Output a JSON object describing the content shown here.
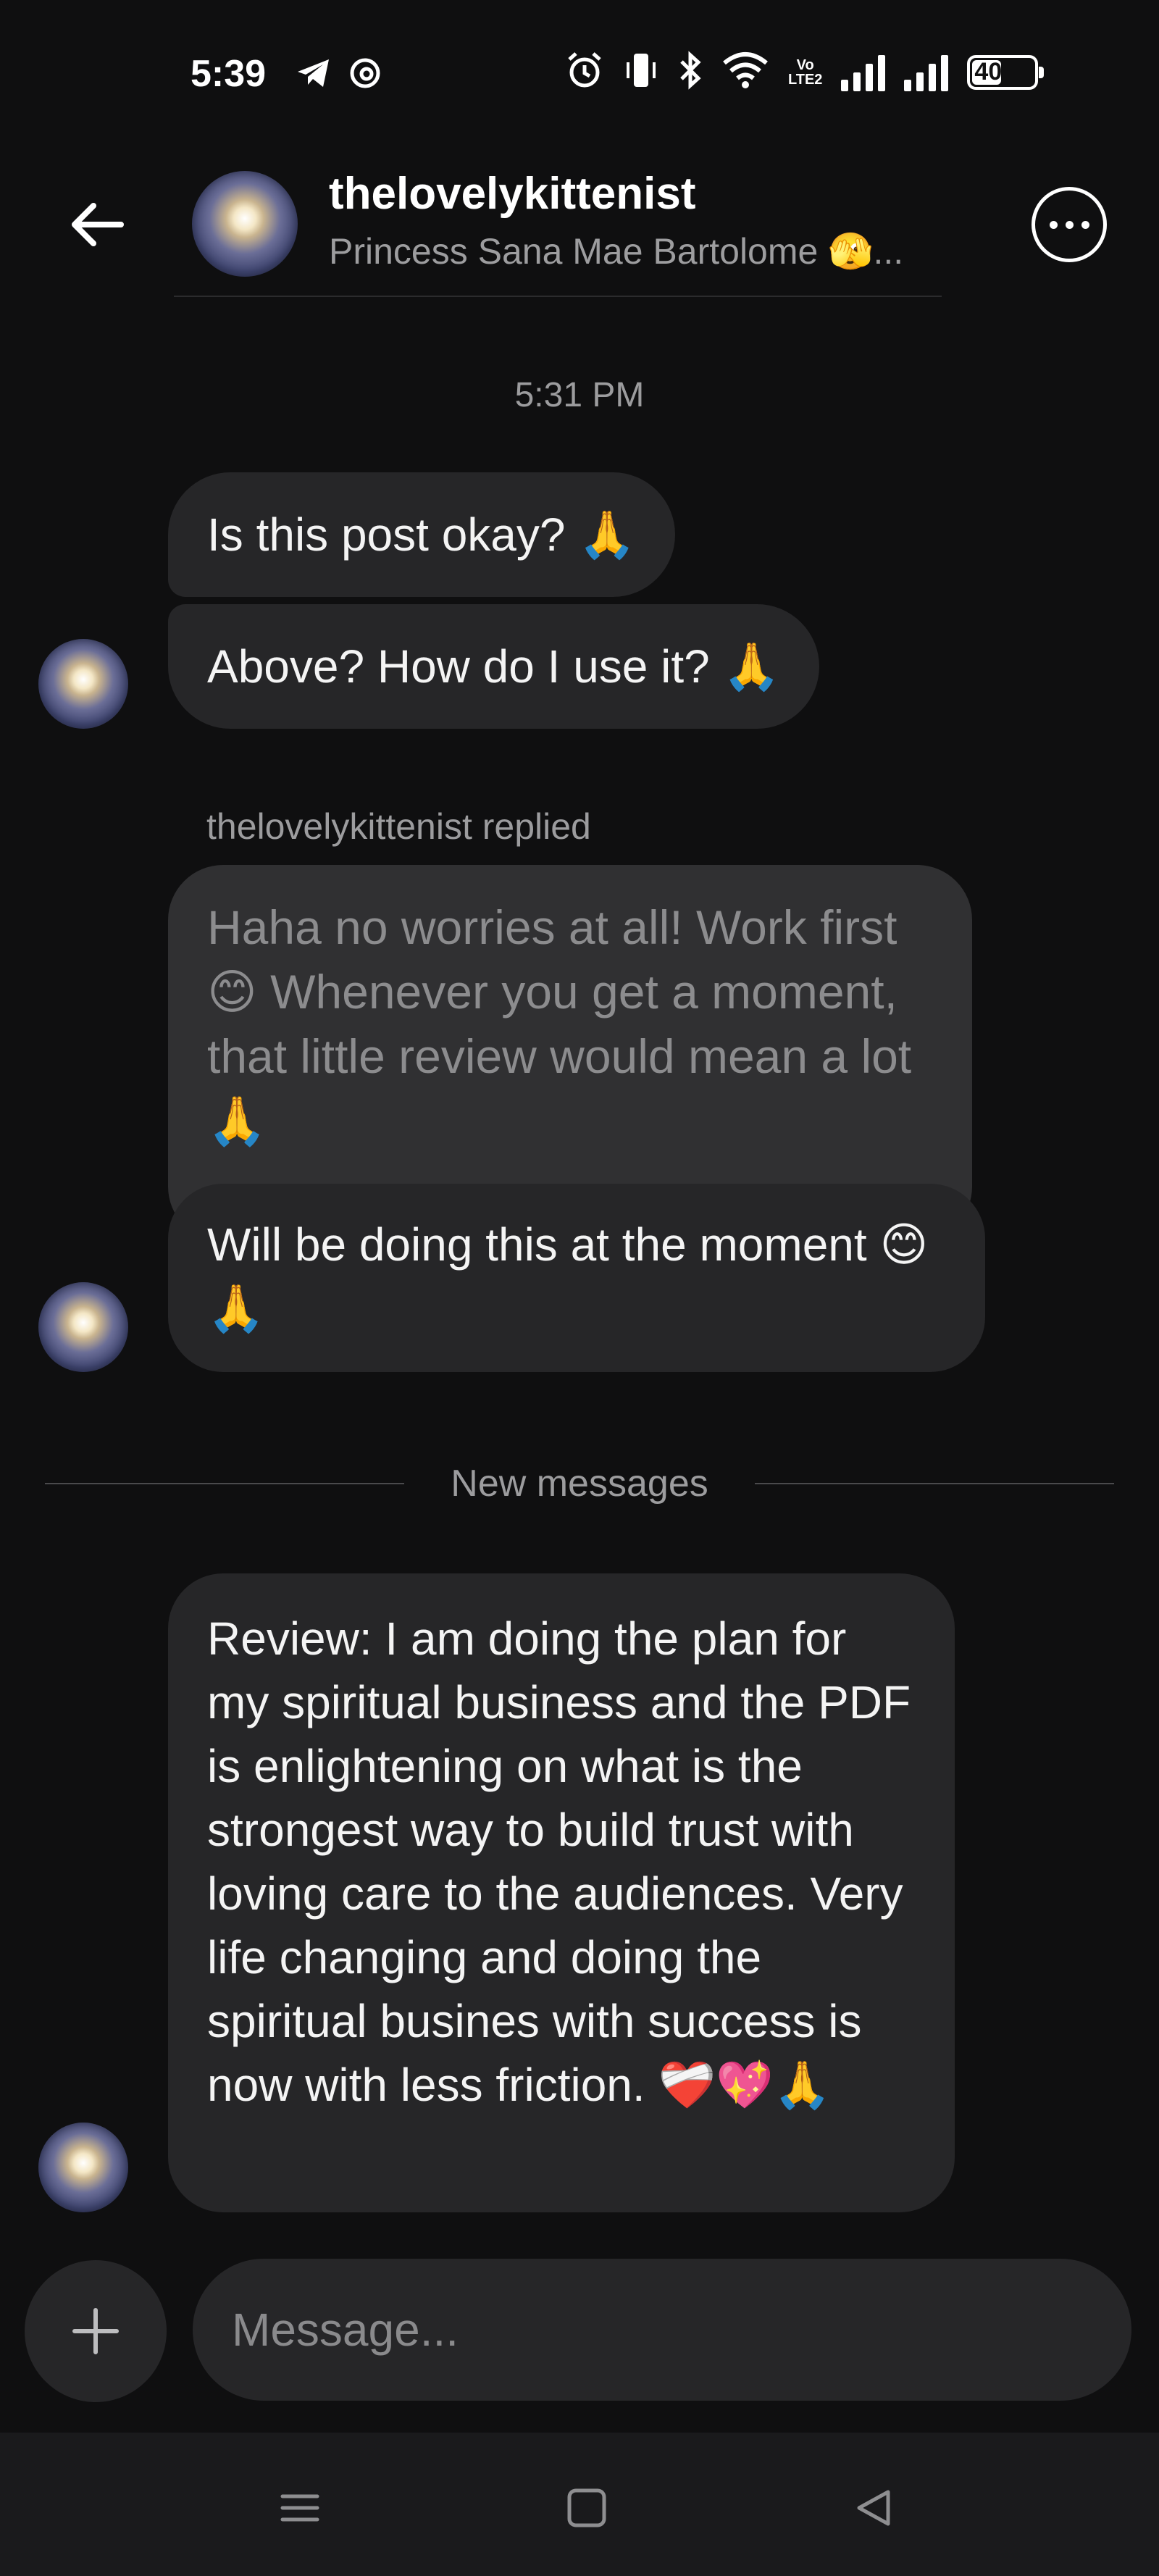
{
  "status_bar": {
    "time": "5:39",
    "network_label": "Vo\nLTE2",
    "battery": "40",
    "icons": [
      "telegram-icon",
      "threads-icon",
      "alarm-icon",
      "vibrate-icon",
      "bluetooth-icon",
      "wifi-icon",
      "signal-icon",
      "battery-icon"
    ]
  },
  "header": {
    "username": "thelovelykittenist",
    "subtitle": "Princess Sana Mae Bartolome 🫣..."
  },
  "conversation": {
    "timestamp": "5:31 PM",
    "messages": [
      {
        "text": "Is this post okay? 🙏"
      },
      {
        "text": "Above? How do I use it? 🙏"
      }
    ],
    "reply": {
      "label": "thelovelykittenist replied",
      "quoted_text": "Haha no worries at all!  Work first 😊 Whenever you get a moment, that little review would mean a lot 🙏",
      "text": "Will be doing this at the moment 😊🙏"
    },
    "new_messages_label": "New messages",
    "review": {
      "text": "Review: I am doing the plan for my spiritual business and the PDF is enlightening on what is the strongest way to build trust with loving care to the audiences. Very life changing and doing the spiritual busines with success is now with less friction. ❤️‍🩹💖🙏"
    }
  },
  "composer": {
    "placeholder": "Message..."
  },
  "colors": {
    "background": "#0f0f10",
    "bubble": "#262628",
    "quoted_bubble": "#303032",
    "secondary_text": "#9c9c9e"
  }
}
